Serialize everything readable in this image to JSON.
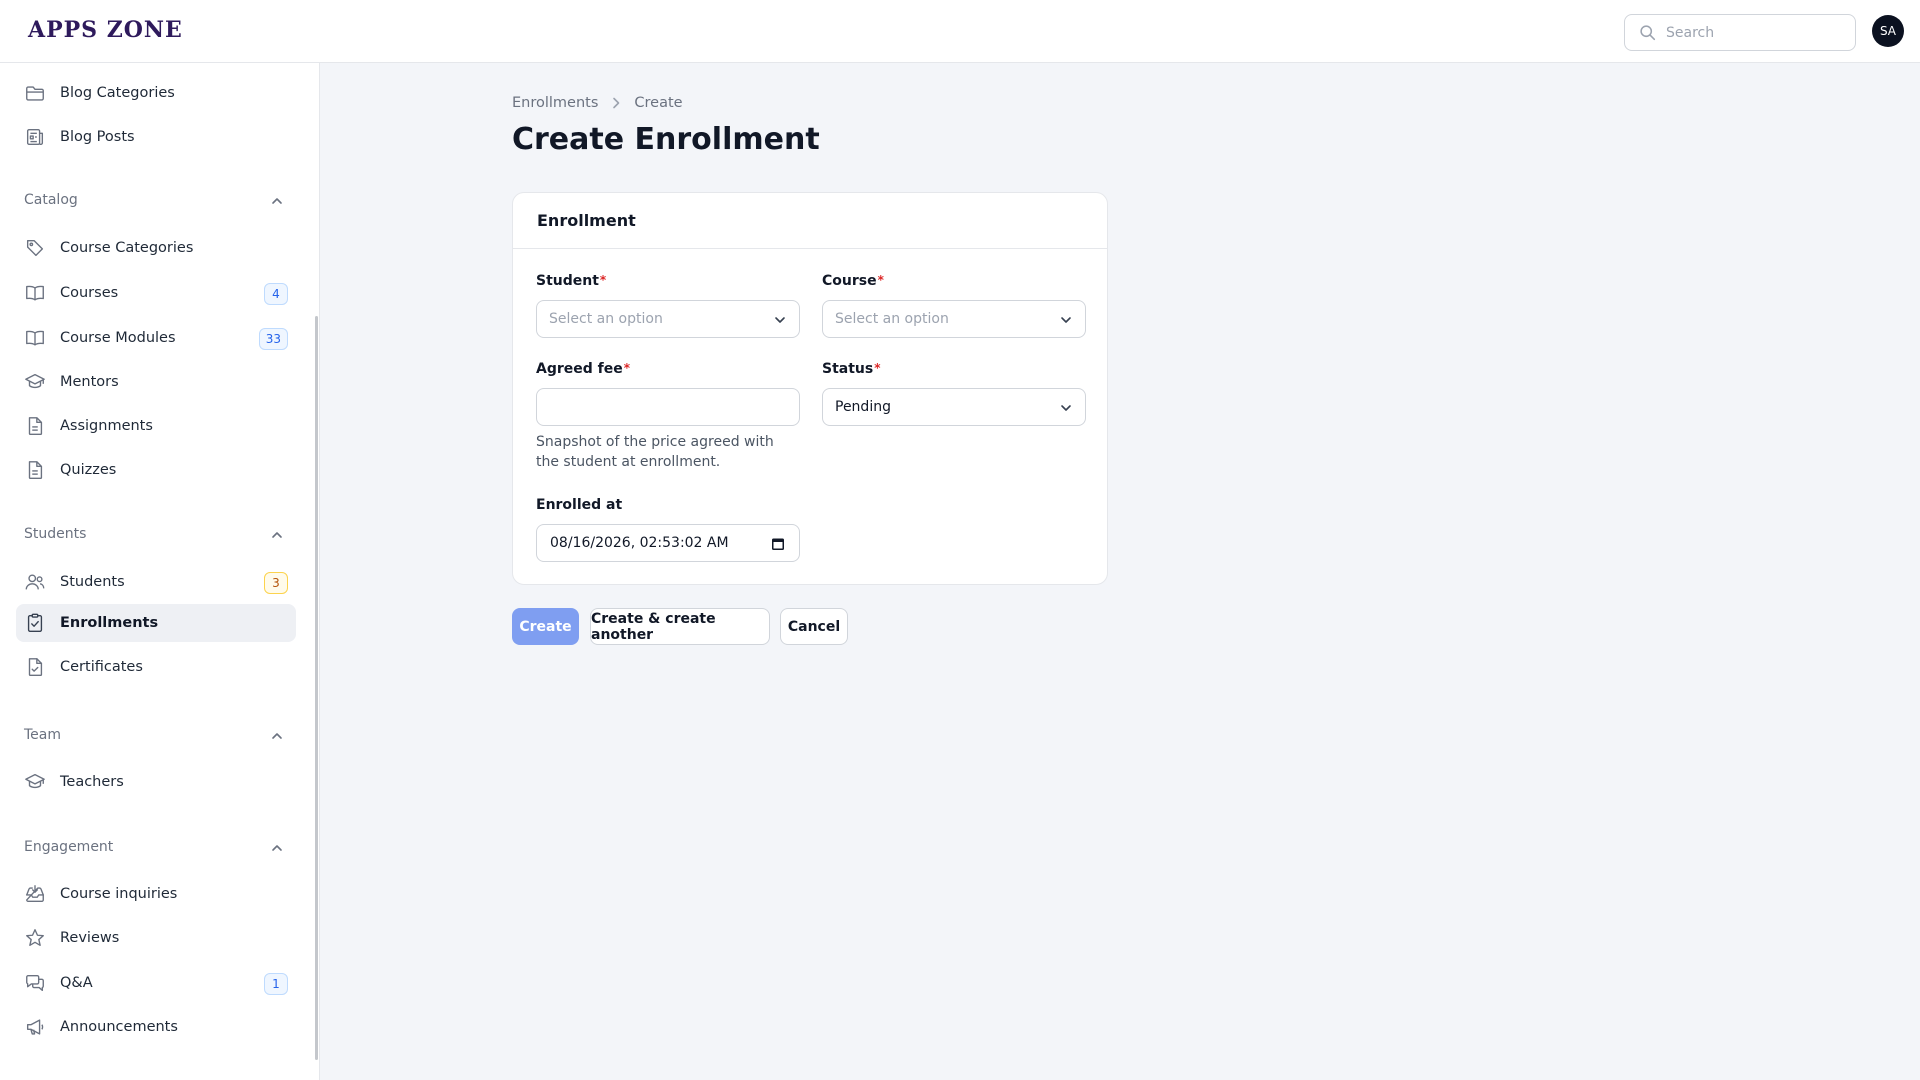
{
  "header": {
    "logo": "APPS ZONE",
    "search_placeholder": "Search",
    "avatar_initials": "SA"
  },
  "sidebar": {
    "items_top": [
      {
        "label": "Blog Categories",
        "icon": "folder-icon"
      },
      {
        "label": "Blog Posts",
        "icon": "newspaper-icon"
      }
    ],
    "groups": [
      {
        "label": "Catalog",
        "items": [
          {
            "label": "Course Categories",
            "icon": "tag-icon"
          },
          {
            "label": "Courses",
            "icon": "book-open-icon",
            "badge": "4"
          },
          {
            "label": "Course Modules",
            "icon": "book-open-icon",
            "badge": "33"
          },
          {
            "label": "Mentors",
            "icon": "academic-cap-icon"
          },
          {
            "label": "Assignments",
            "icon": "document-text-icon"
          },
          {
            "label": "Quizzes",
            "icon": "document-text-icon"
          }
        ]
      },
      {
        "label": "Students",
        "items": [
          {
            "label": "Students",
            "icon": "users-icon",
            "badge": "3"
          },
          {
            "label": "Enrollments",
            "icon": "clipboard-check-icon",
            "active": true
          },
          {
            "label": "Certificates",
            "icon": "document-check-icon"
          }
        ]
      },
      {
        "label": "Team",
        "items": [
          {
            "label": "Teachers",
            "icon": "academic-cap-icon"
          }
        ]
      },
      {
        "label": "Engagement",
        "items": [
          {
            "label": "Course inquiries",
            "icon": "inbox-icon"
          },
          {
            "label": "Reviews",
            "icon": "star-icon"
          },
          {
            "label": "Q&A",
            "icon": "chat-bubbles-icon",
            "badge": "1"
          },
          {
            "label": "Announcements",
            "icon": "megaphone-icon"
          }
        ]
      }
    ]
  },
  "breadcrumb": {
    "parent": "Enrollments",
    "current": "Create"
  },
  "page_title": "Create Enrollment",
  "form": {
    "section_title": "Enrollment",
    "student": {
      "label": "Student",
      "required_mark": "*",
      "placeholder": "Select an option"
    },
    "course": {
      "label": "Course",
      "required_mark": "*",
      "placeholder": "Select an option"
    },
    "agreed_fee": {
      "label": "Agreed fee",
      "required_mark": "*",
      "value": "",
      "help": "Snapshot of the price agreed with the student at enrollment."
    },
    "status": {
      "label": "Status",
      "required_mark": "*",
      "value": "Pending"
    },
    "enrolled_at": {
      "label": "Enrolled at",
      "value": "08/16/2026, 02:53:02 AM"
    }
  },
  "actions": {
    "create": "Create",
    "create_another": "Create & create another",
    "cancel": "Cancel"
  },
  "colors": {
    "primary_button": "#7f9ef1",
    "required": "#dc2626",
    "badge_info": "#2563eb",
    "badge_warn": "#b45309"
  }
}
